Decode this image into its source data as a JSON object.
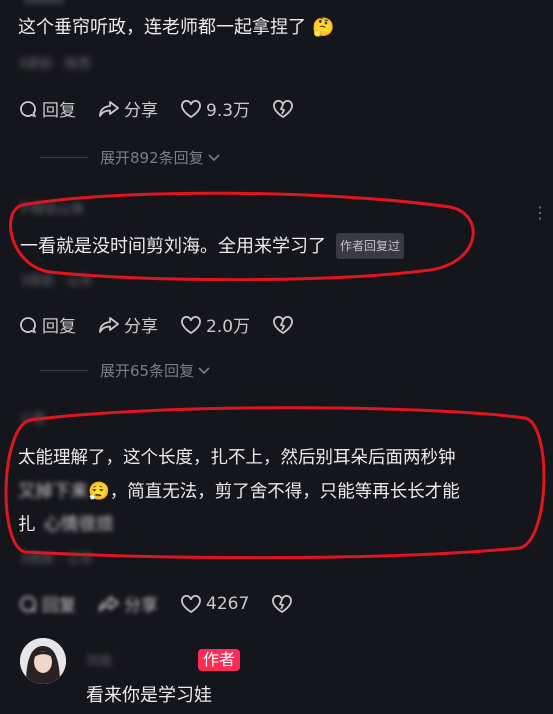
{
  "comments": [
    {
      "text": "这个垂帘听政，连老师都一起拿捏了",
      "emoji": "🤔",
      "meta": "3周前 · 陕西",
      "reply": "回复",
      "share": "分享",
      "likes": "9.3万",
      "expand": "展开892条回复"
    },
    {
      "username": "不相信山海",
      "text": "一看就是没时间剪刘海。全用来学习了",
      "badge": "作者回复过",
      "meta": "3周前 · 山东",
      "reply": "回复",
      "share": "分享",
      "likes": "2.0万",
      "expand": "展开65条回复"
    },
    {
      "username": "小熊",
      "line1": "太能理解了，这个长度，扎不上，然后别耳朵后面两秒钟",
      "line2_blur": "又掉下来",
      "emoji": "😮‍💨",
      "line2": "，简直无法，剪了舍不得，只能等再长长才能",
      "line3": "扎",
      "line3_blur": "心情很烦",
      "meta": "3周前 · 江苏",
      "reply_blur": "回复",
      "share_blur": "分享",
      "likes": "4267"
    }
  ],
  "reply": {
    "username": "刘佳",
    "author_badge": "作者",
    "text": "看来你是学习娃"
  },
  "colors": {
    "background": "#15161b",
    "accent": "#fe2c55",
    "annotation": "#e0151f"
  }
}
